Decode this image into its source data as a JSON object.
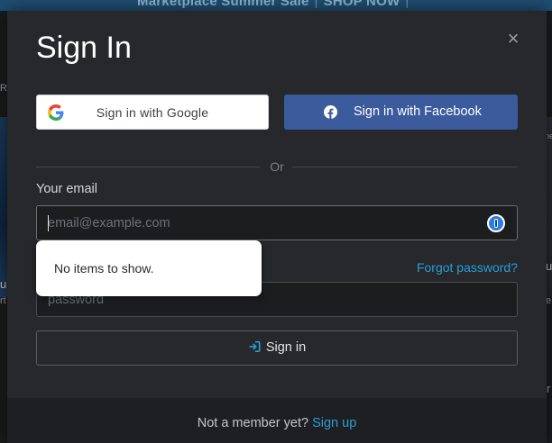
{
  "banner": {
    "promo_text": "Marketplace Summer Sale",
    "promo_cta": "SHOP NOW"
  },
  "background": {
    "frag_left_1": "RK",
    "frag_left_2": "u",
    "frag_left_3": "rt",
    "frag_right_1": "ne",
    "frag_right_2": "u",
    "frag_right_3": "e",
    "frag_right_4": "r"
  },
  "modal": {
    "title": "Sign In",
    "close_glyph": "×",
    "google_label": "Sign in with Google",
    "facebook_label": "Sign in with Facebook",
    "divider_text": "Or",
    "email_label": "Your email",
    "email_placeholder": "email@example.com",
    "email_value": "",
    "forgot_password": "Forgot password?",
    "password_placeholder": "password",
    "password_value": "",
    "signin_label": "Sign in",
    "footer_text": "Not a member yet?",
    "signup_link": "Sign up"
  },
  "autofill": {
    "message": "No items to show."
  },
  "icons": {
    "google": "google-icon",
    "facebook": "facebook-icon",
    "password_manager": "password-manager-icon",
    "signin": "sign-in-arrow-icon",
    "close": "close-icon"
  },
  "colors": {
    "accent_link": "#2a9fd8",
    "facebook_blue": "#3b5b9d",
    "modal_bg": "#27282b",
    "footer_bg": "#1e1f22"
  }
}
